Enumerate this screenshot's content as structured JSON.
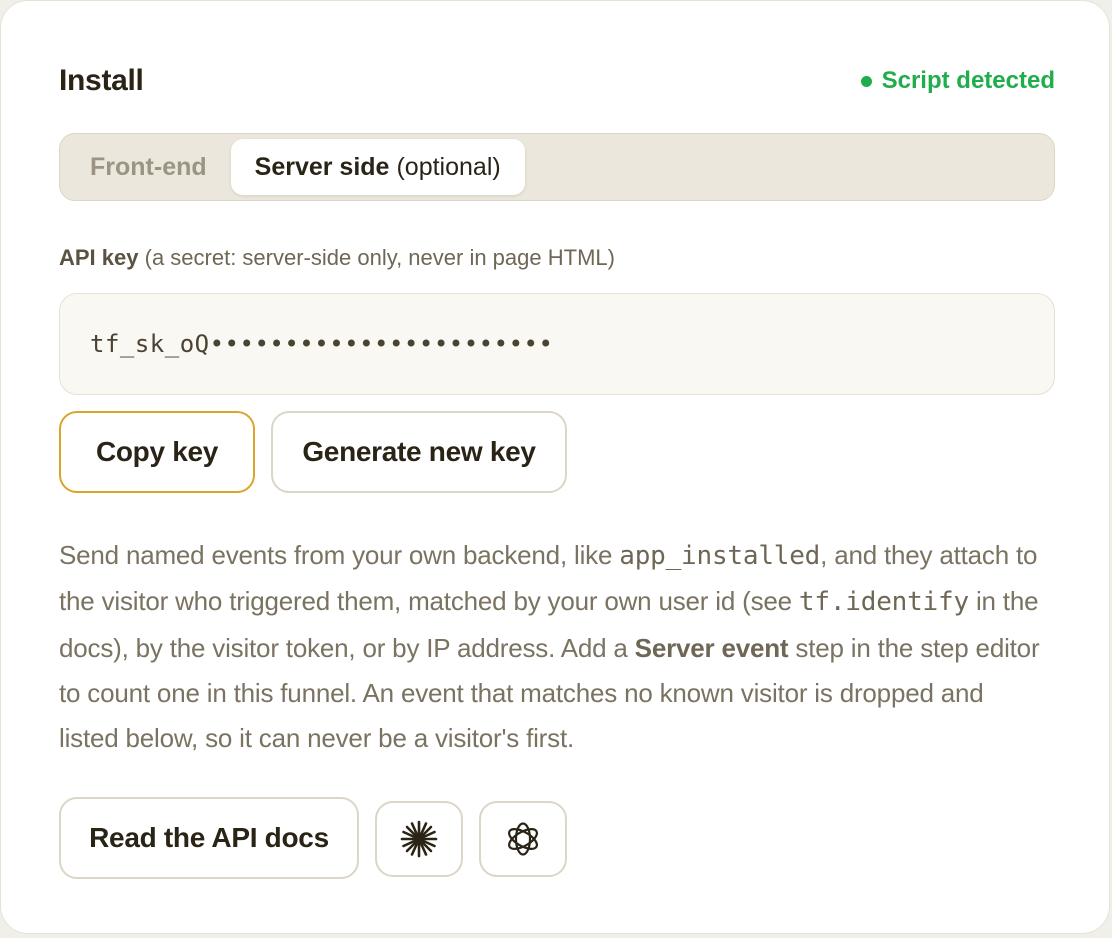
{
  "header": {
    "title": "Install",
    "status_text": "Script detected",
    "status_color": "#1fae4b"
  },
  "tabs": {
    "frontend_label": "Front-end",
    "server_label_bold": "Server side",
    "server_label_extra": "(optional)",
    "active": "Server side"
  },
  "api_key": {
    "label_bold": "API key",
    "label_extra": "(a secret: server-side only, never in page HTML)",
    "masked_value": "tf_sk_oQ•••••••••••••••••••••••"
  },
  "buttons": {
    "copy_key": "Copy key",
    "generate_key": "Generate new key",
    "read_docs": "Read the API docs",
    "copy_key_border_color": "#dba52c"
  },
  "description": {
    "part1": "Send named events from your own backend, like ",
    "code1": "app_installed",
    "part2": ", and they attach to the visitor who triggered them, matched by your own user id (see ",
    "code2": "tf.identify",
    "part3": " in the docs), by the visitor token, or by IP address. Add a ",
    "bold1": "Server event",
    "part4": " step in the step editor to count one in this funnel. An event that matches no known visitor is dropped and listed below, so it can never be a visitor's first."
  },
  "icons": {
    "claude": "claude-sparkle-icon",
    "openai": "openai-knot-icon"
  }
}
